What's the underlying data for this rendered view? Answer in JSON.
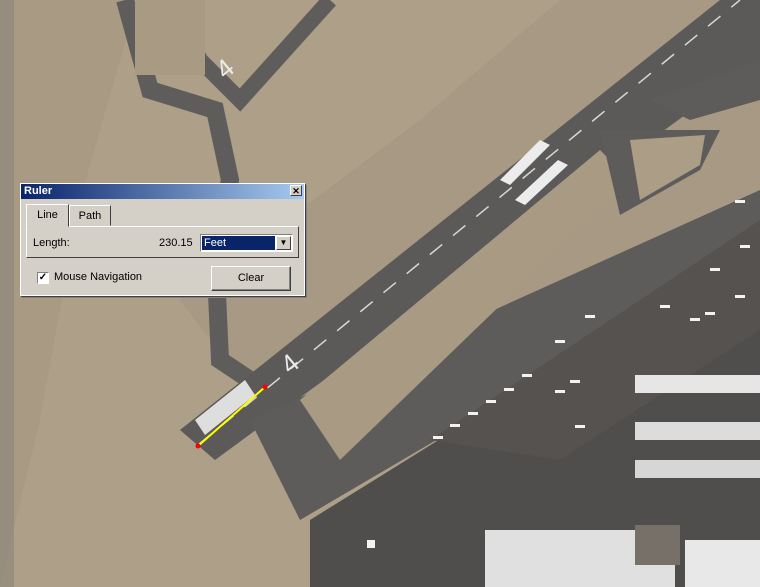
{
  "ruler": {
    "title": "Ruler",
    "close_glyph": "✕",
    "tabs": [
      {
        "label": "Line",
        "active": true
      },
      {
        "label": "Path",
        "active": false
      }
    ],
    "length_label": "Length:",
    "length_value": "230.15",
    "units_selected": "Feet",
    "mouse_navigation_label": "Mouse Navigation",
    "mouse_navigation_checked": true,
    "checkmark": "✓",
    "clear_label": "Clear"
  },
  "map": {
    "runway_number": "4",
    "measure_line_color": "#ffff00",
    "measure_point_color": "#ff0000"
  }
}
